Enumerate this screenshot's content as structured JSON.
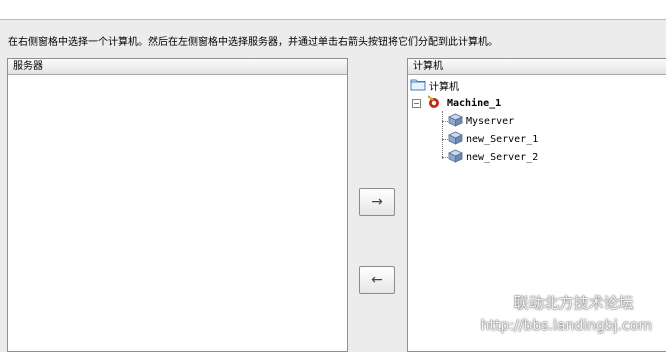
{
  "instruction": "在右侧窗格中选择一个计算机。然后在左侧窗格中选择服务器，并通过单击右箭头按钮将它们分配到此计算机。",
  "left_panel": {
    "header": "服务器"
  },
  "right_panel": {
    "header": "计算机",
    "tree": {
      "root_label": "计算机",
      "machine_label": "Machine_1",
      "servers": [
        "Myserver",
        "new_Server_1",
        "new_Server_2"
      ]
    }
  },
  "buttons": {
    "assign_glyph": "→",
    "remove_glyph": "←"
  },
  "watermark": {
    "name": "联动北方技术论坛",
    "url": "http://bbs.landingbj.com"
  },
  "icons": {
    "folder": "folder-icon",
    "machine": "machine-icon",
    "server": "server-cube-icon",
    "collapse": "collapse-icon"
  },
  "colors": {
    "accent_machine": "#c0281a",
    "folder": "#3a7fc4"
  }
}
